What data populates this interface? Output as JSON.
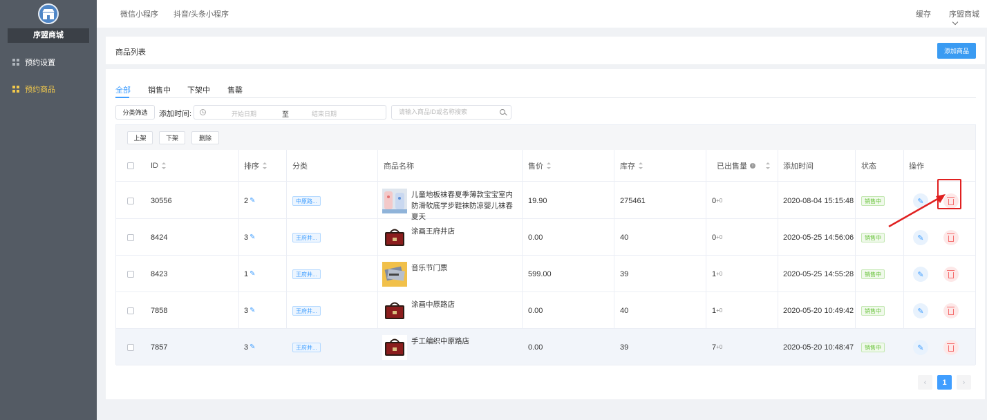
{
  "sidebar": {
    "brand": "序盟商城",
    "items": [
      {
        "label": "预约设置",
        "active": false
      },
      {
        "label": "预约商品",
        "active": true
      }
    ]
  },
  "topbar": {
    "tabs": [
      "微信小程序",
      "抖音/头条小程序"
    ],
    "cache": "缓存",
    "store": "序盟商城"
  },
  "header": {
    "title": "商品列表",
    "add_button": "添加商品"
  },
  "tabs": [
    "全部",
    "销售中",
    "下架中",
    "售罄"
  ],
  "filters": {
    "category_button": "分类筛选",
    "date_label": "添加时间:",
    "start_placeholder": "开始日期",
    "separator": "至",
    "end_placeholder": "结束日期",
    "search_placeholder": "请输入商品ID或名称搜索"
  },
  "toolbar": {
    "on_shelf": "上架",
    "off_shelf": "下架",
    "delete": "删除"
  },
  "columns": {
    "id": "ID",
    "sort": "排序",
    "category": "分类",
    "name": "商品名称",
    "price": "售价",
    "stock": "库存",
    "sold": "已出售量",
    "added": "添加时间",
    "status": "状态",
    "actions": "操作"
  },
  "rows": [
    {
      "id": "30556",
      "sort": "2",
      "category": "中原路...",
      "name": "儿童地板袜春夏季薄款宝宝室内防滑软底学步鞋袜防凉婴儿袜春夏天",
      "price": "19.90",
      "stock": "275461",
      "sold": "0",
      "sold_extra": "+0",
      "added": "2020-08-04 15:15:48",
      "status": "销售中",
      "thumb": "socks"
    },
    {
      "id": "8424",
      "sort": "3",
      "category": "王府井...",
      "name": "涂画王府井店",
      "price": "0.00",
      "stock": "40",
      "sold": "0",
      "sold_extra": "+0",
      "added": "2020-05-25 14:56:06",
      "status": "销售中",
      "thumb": "bag"
    },
    {
      "id": "8423",
      "sort": "1",
      "category": "王府井...",
      "name": "音乐节门票",
      "price": "599.00",
      "stock": "39",
      "sold": "1",
      "sold_extra": "+0",
      "added": "2020-05-25 14:55:28",
      "status": "销售中",
      "thumb": "ticket"
    },
    {
      "id": "7858",
      "sort": "3",
      "category": "王府井...",
      "name": "涂画中原路店",
      "price": "0.00",
      "stock": "40",
      "sold": "1",
      "sold_extra": "+0",
      "added": "2020-05-20 10:49:42",
      "status": "销售中",
      "thumb": "bag"
    },
    {
      "id": "7857",
      "sort": "3",
      "category": "王府井...",
      "name": "手工编织中原路店",
      "price": "0.00",
      "stock": "39",
      "sold": "7",
      "sold_extra": "+0",
      "added": "2020-05-20 10:48:47",
      "status": "销售中",
      "thumb": "bag"
    }
  ],
  "pagination": {
    "current": "1"
  },
  "colors": {
    "primary": "#409eff",
    "sidebar": "#545b64",
    "active_menu": "#f2c94c",
    "danger": "#f56c6c",
    "success": "#67c23a",
    "annotation": "#e02020"
  }
}
